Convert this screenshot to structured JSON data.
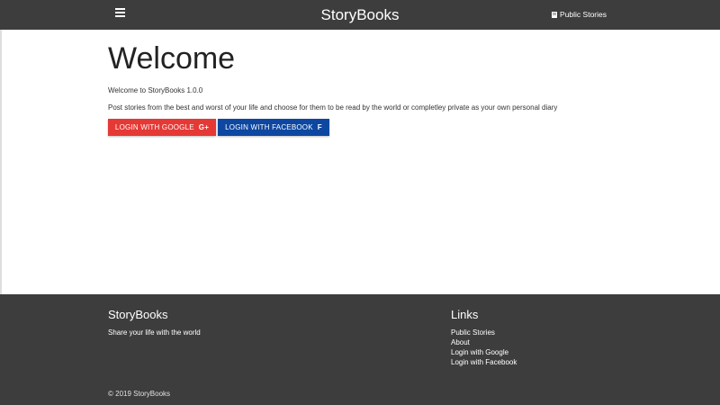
{
  "navbar": {
    "menu_icon": "hamburger-menu-icon",
    "brand": "StoryBooks",
    "public_stories_icon": "book-icon",
    "public_stories_label": "Public Stories"
  },
  "main": {
    "title": "Welcome",
    "version_text": "Welcome to StoryBooks 1.0.0",
    "lead_text": "Post stories from the best and worst of your life and choose for them to be read by the world or completley private as your own personal diary",
    "google_button": {
      "label": "Login With Google",
      "icon": "google-plus-icon",
      "icon_glyph": "G+",
      "color": "#e53935"
    },
    "facebook_button": {
      "label": "Login With Facebook",
      "icon": "facebook-icon",
      "icon_glyph": "f",
      "color": "#0d47a1"
    }
  },
  "footer": {
    "brand": "StoryBooks",
    "tagline": "Share your life with the world",
    "links_title": "Links",
    "links": [
      {
        "label": "Public Stories"
      },
      {
        "label": "About"
      },
      {
        "label": "Login with Google"
      },
      {
        "label": "Login with Facebook"
      }
    ],
    "copyright": "© 2019 StoryBooks"
  },
  "colors": {
    "nav_background": "#3d3d3d",
    "footer_background": "#3d3d3d",
    "google_red": "#e53935",
    "facebook_blue": "#0d47a1"
  }
}
